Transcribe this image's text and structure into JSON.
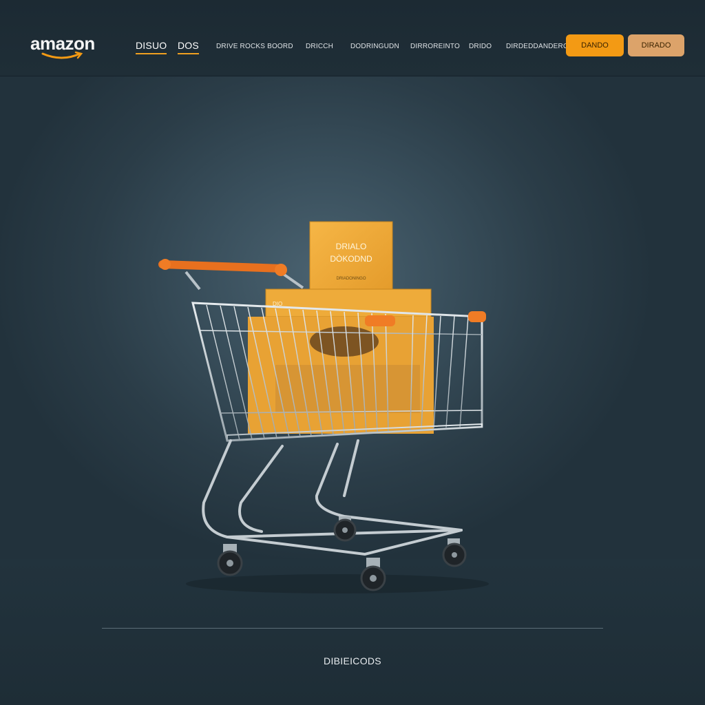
{
  "header": {
    "logo_text": "amazon",
    "nav": [
      {
        "label": "DISUO",
        "active": true
      },
      {
        "label": "DOS",
        "active": true
      },
      {
        "label": "DRIVE ROCKS BOORD",
        "active": false
      },
      {
        "label": "DRICCH",
        "active": false
      },
      {
        "label": "DODRINGUDN",
        "active": false
      },
      {
        "label": "DIRROREINTO",
        "active": false
      },
      {
        "label": "DRIDO",
        "active": false
      },
      {
        "label": "DIRDEDDANDERO",
        "active": false
      }
    ],
    "primary_button": "DANDO",
    "secondary_button": "DIRADO"
  },
  "hero": {
    "box_title_line1": "DRIALO",
    "box_title_line2": "DÒKODND",
    "box_subtitle": "DRIADONINGO",
    "crate_label": "DIO"
  },
  "footer": {
    "text": "DIBIEICODS"
  },
  "colors": {
    "accent": "#f39a14",
    "secondary": "#dca36a",
    "header_bg": "#1c2a33",
    "background": "#2a3b46",
    "cart_handle": "#e8701e"
  }
}
